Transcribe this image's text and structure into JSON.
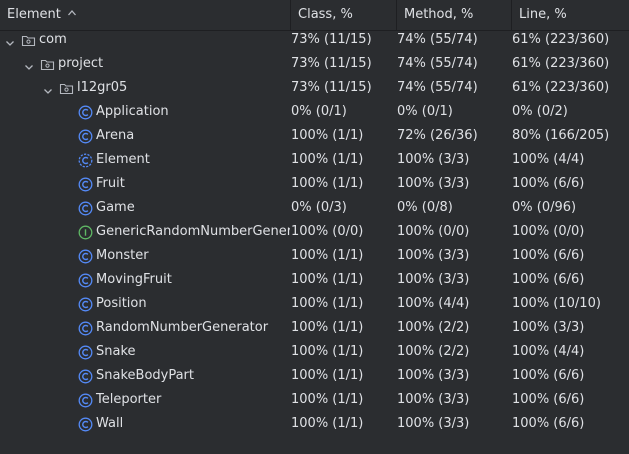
{
  "header": {
    "element": "Element",
    "class": "Class, %",
    "method": "Method, %",
    "line": "Line, %"
  },
  "rows": [
    {
      "name": "com",
      "icon": "package-folder-icon",
      "class": "73% (11/15)",
      "method": "74% (55/74)",
      "line": "61% (223/360)"
    },
    {
      "name": "project",
      "icon": "package-folder-icon",
      "class": "73% (11/15)",
      "method": "74% (55/74)",
      "line": "61% (223/360)"
    },
    {
      "name": "l12gr05",
      "icon": "package-folder-icon",
      "class": "73% (11/15)",
      "method": "74% (55/74)",
      "line": "61% (223/360)"
    },
    {
      "name": "Application",
      "icon": "class-icon",
      "class": "0% (0/1)",
      "method": "0% (0/1)",
      "line": "0% (0/2)"
    },
    {
      "name": "Arena",
      "icon": "class-icon",
      "class": "100% (1/1)",
      "method": "72% (26/36)",
      "line": "80% (166/205)"
    },
    {
      "name": "Element",
      "icon": "abstract-class-icon",
      "class": "100% (1/1)",
      "method": "100% (3/3)",
      "line": "100% (4/4)"
    },
    {
      "name": "Fruit",
      "icon": "class-icon",
      "class": "100% (1/1)",
      "method": "100% (3/3)",
      "line": "100% (6/6)"
    },
    {
      "name": "Game",
      "icon": "class-icon",
      "class": "0% (0/3)",
      "method": "0% (0/8)",
      "line": "0% (0/96)"
    },
    {
      "name": "GenericRandomNumberGenera",
      "icon": "interface-icon",
      "class": "100% (0/0)",
      "method": "100% (0/0)",
      "line": "100% (0/0)"
    },
    {
      "name": "Monster",
      "icon": "class-icon",
      "class": "100% (1/1)",
      "method": "100% (3/3)",
      "line": "100% (6/6)"
    },
    {
      "name": "MovingFruit",
      "icon": "class-icon",
      "class": "100% (1/1)",
      "method": "100% (3/3)",
      "line": "100% (6/6)"
    },
    {
      "name": "Position",
      "icon": "class-icon",
      "class": "100% (1/1)",
      "method": "100% (4/4)",
      "line": "100% (10/10)"
    },
    {
      "name": "RandomNumberGenerator",
      "icon": "class-icon",
      "class": "100% (1/1)",
      "method": "100% (2/2)",
      "line": "100% (3/3)"
    },
    {
      "name": "Snake",
      "icon": "class-icon",
      "class": "100% (1/1)",
      "method": "100% (2/2)",
      "line": "100% (4/4)"
    },
    {
      "name": "SnakeBodyPart",
      "icon": "class-icon",
      "class": "100% (1/1)",
      "method": "100% (3/3)",
      "line": "100% (6/6)"
    },
    {
      "name": "Teleporter",
      "icon": "class-icon",
      "class": "100% (1/1)",
      "method": "100% (3/3)",
      "line": "100% (6/6)"
    },
    {
      "name": "Wall",
      "icon": "class-icon",
      "class": "100% (1/1)",
      "method": "100% (3/3)",
      "line": "100% (6/6)"
    }
  ],
  "colors": {
    "background": "#2b2d30",
    "class_icon": "#548af7",
    "interface_icon": "#5fb865",
    "text": "#dfe1e5"
  }
}
